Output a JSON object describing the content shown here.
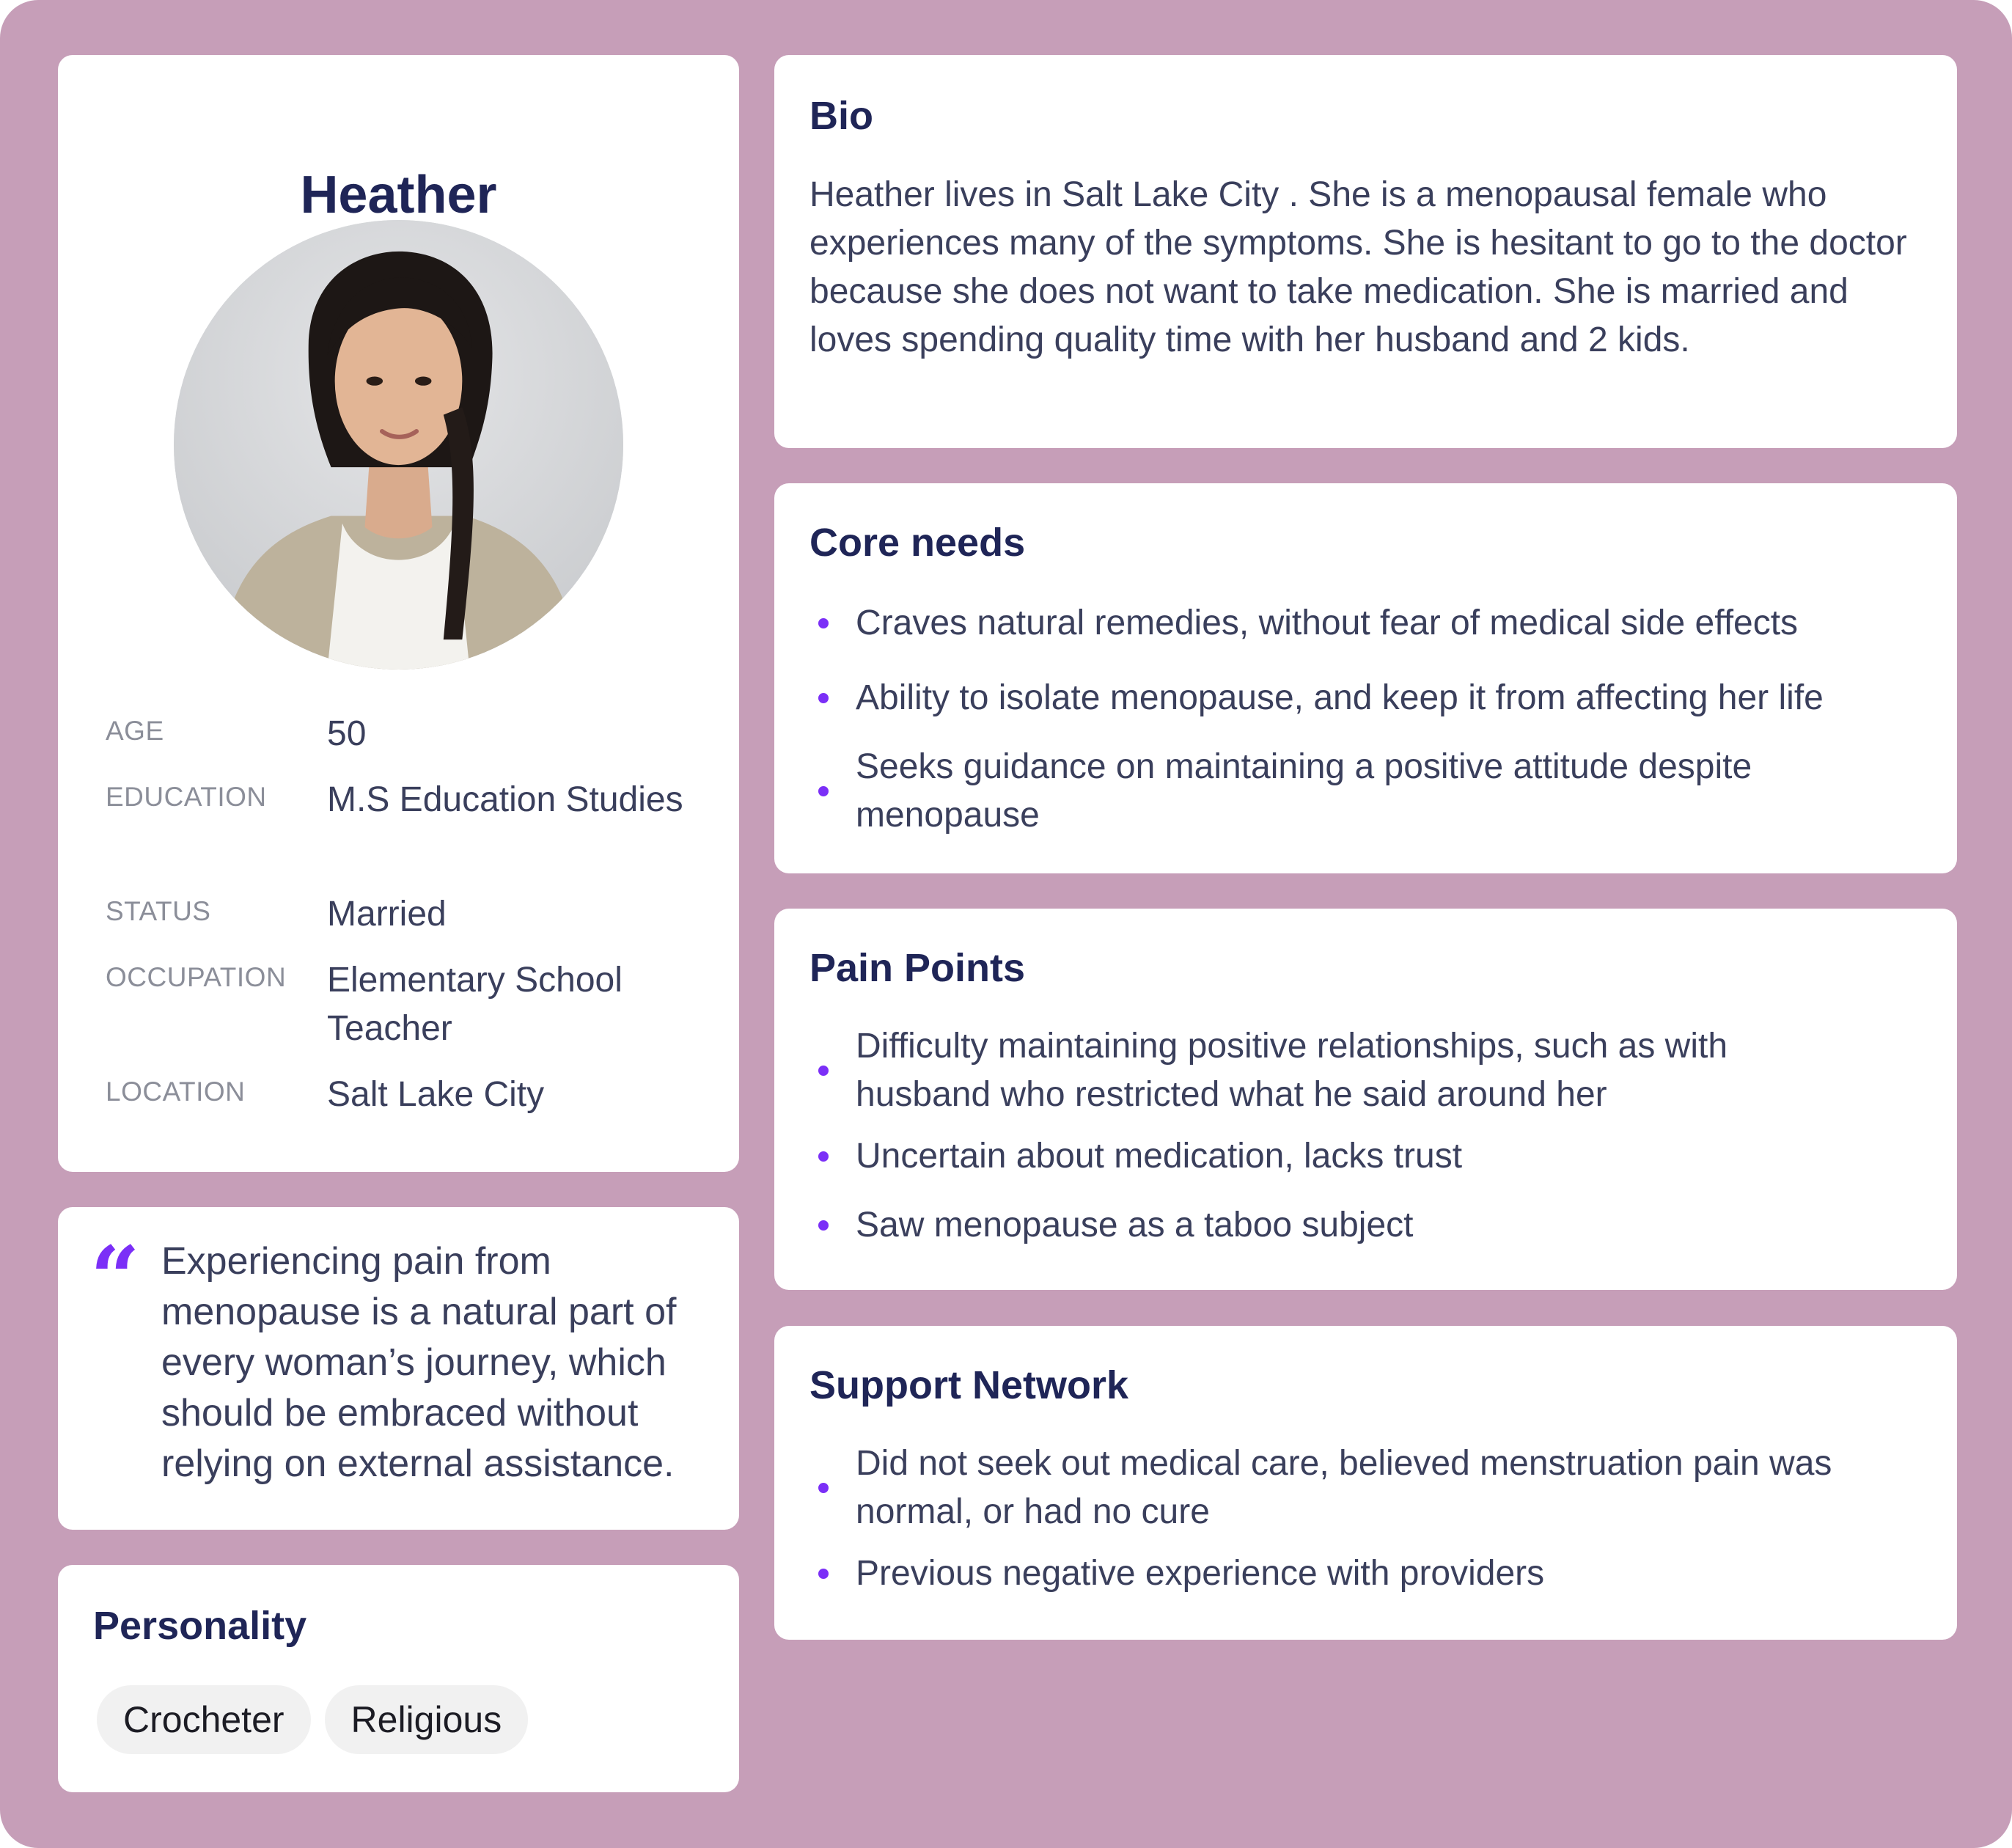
{
  "profile": {
    "name": "Heather",
    "fields": [
      {
        "label": "AGE",
        "value": "50"
      },
      {
        "label": "EDUCATION",
        "value": "M.S Education Studies"
      },
      {
        "label": "STATUS",
        "value": "Married"
      },
      {
        "label": "OCCUPATION",
        "value": "Elementary School Teacher"
      },
      {
        "label": "LOCATION",
        "value": "Salt Lake City"
      }
    ]
  },
  "quote": {
    "mark": "“",
    "text": "Experiencing pain from menopause is a natural part of every woman’s journey, which should be embraced without relying on external assistance."
  },
  "personality": {
    "title": "Personality",
    "tags": [
      "Crocheter",
      "Religious"
    ]
  },
  "bio": {
    "title": "Bio",
    "text": "Heather lives in Salt Lake City . She is a menopausal female who experiences many of the symptoms. She is hesitant to go to the doctor because she does not want to take medication. She is married and loves spending quality time with her husband and 2 kids."
  },
  "core_needs": {
    "title": "Core needs",
    "items": [
      "Craves natural remedies, without fear of medical side effects",
      "Ability to isolate menopause, and keep it from affecting her life",
      "Seeks guidance on maintaining a positive attitude despite menopause"
    ]
  },
  "pain_points": {
    "title": "Pain Points",
    "items": [
      "Difficulty maintaining positive relationships, such as with husband who restricted what he said around her",
      "Uncertain about medication, lacks trust",
      "Saw menopause as a taboo subject"
    ]
  },
  "support_network": {
    "title": "Support Network",
    "items": [
      "Did not seek out medical care, believed menstruation pain was normal, or had no cure",
      "Previous negative experience with providers"
    ]
  },
  "colors": {
    "background": "#c69eb8",
    "accent": "#7b2ff7",
    "heading": "#1f2557",
    "body_text": "#3a3f5c",
    "label_text": "#8b8e99"
  }
}
